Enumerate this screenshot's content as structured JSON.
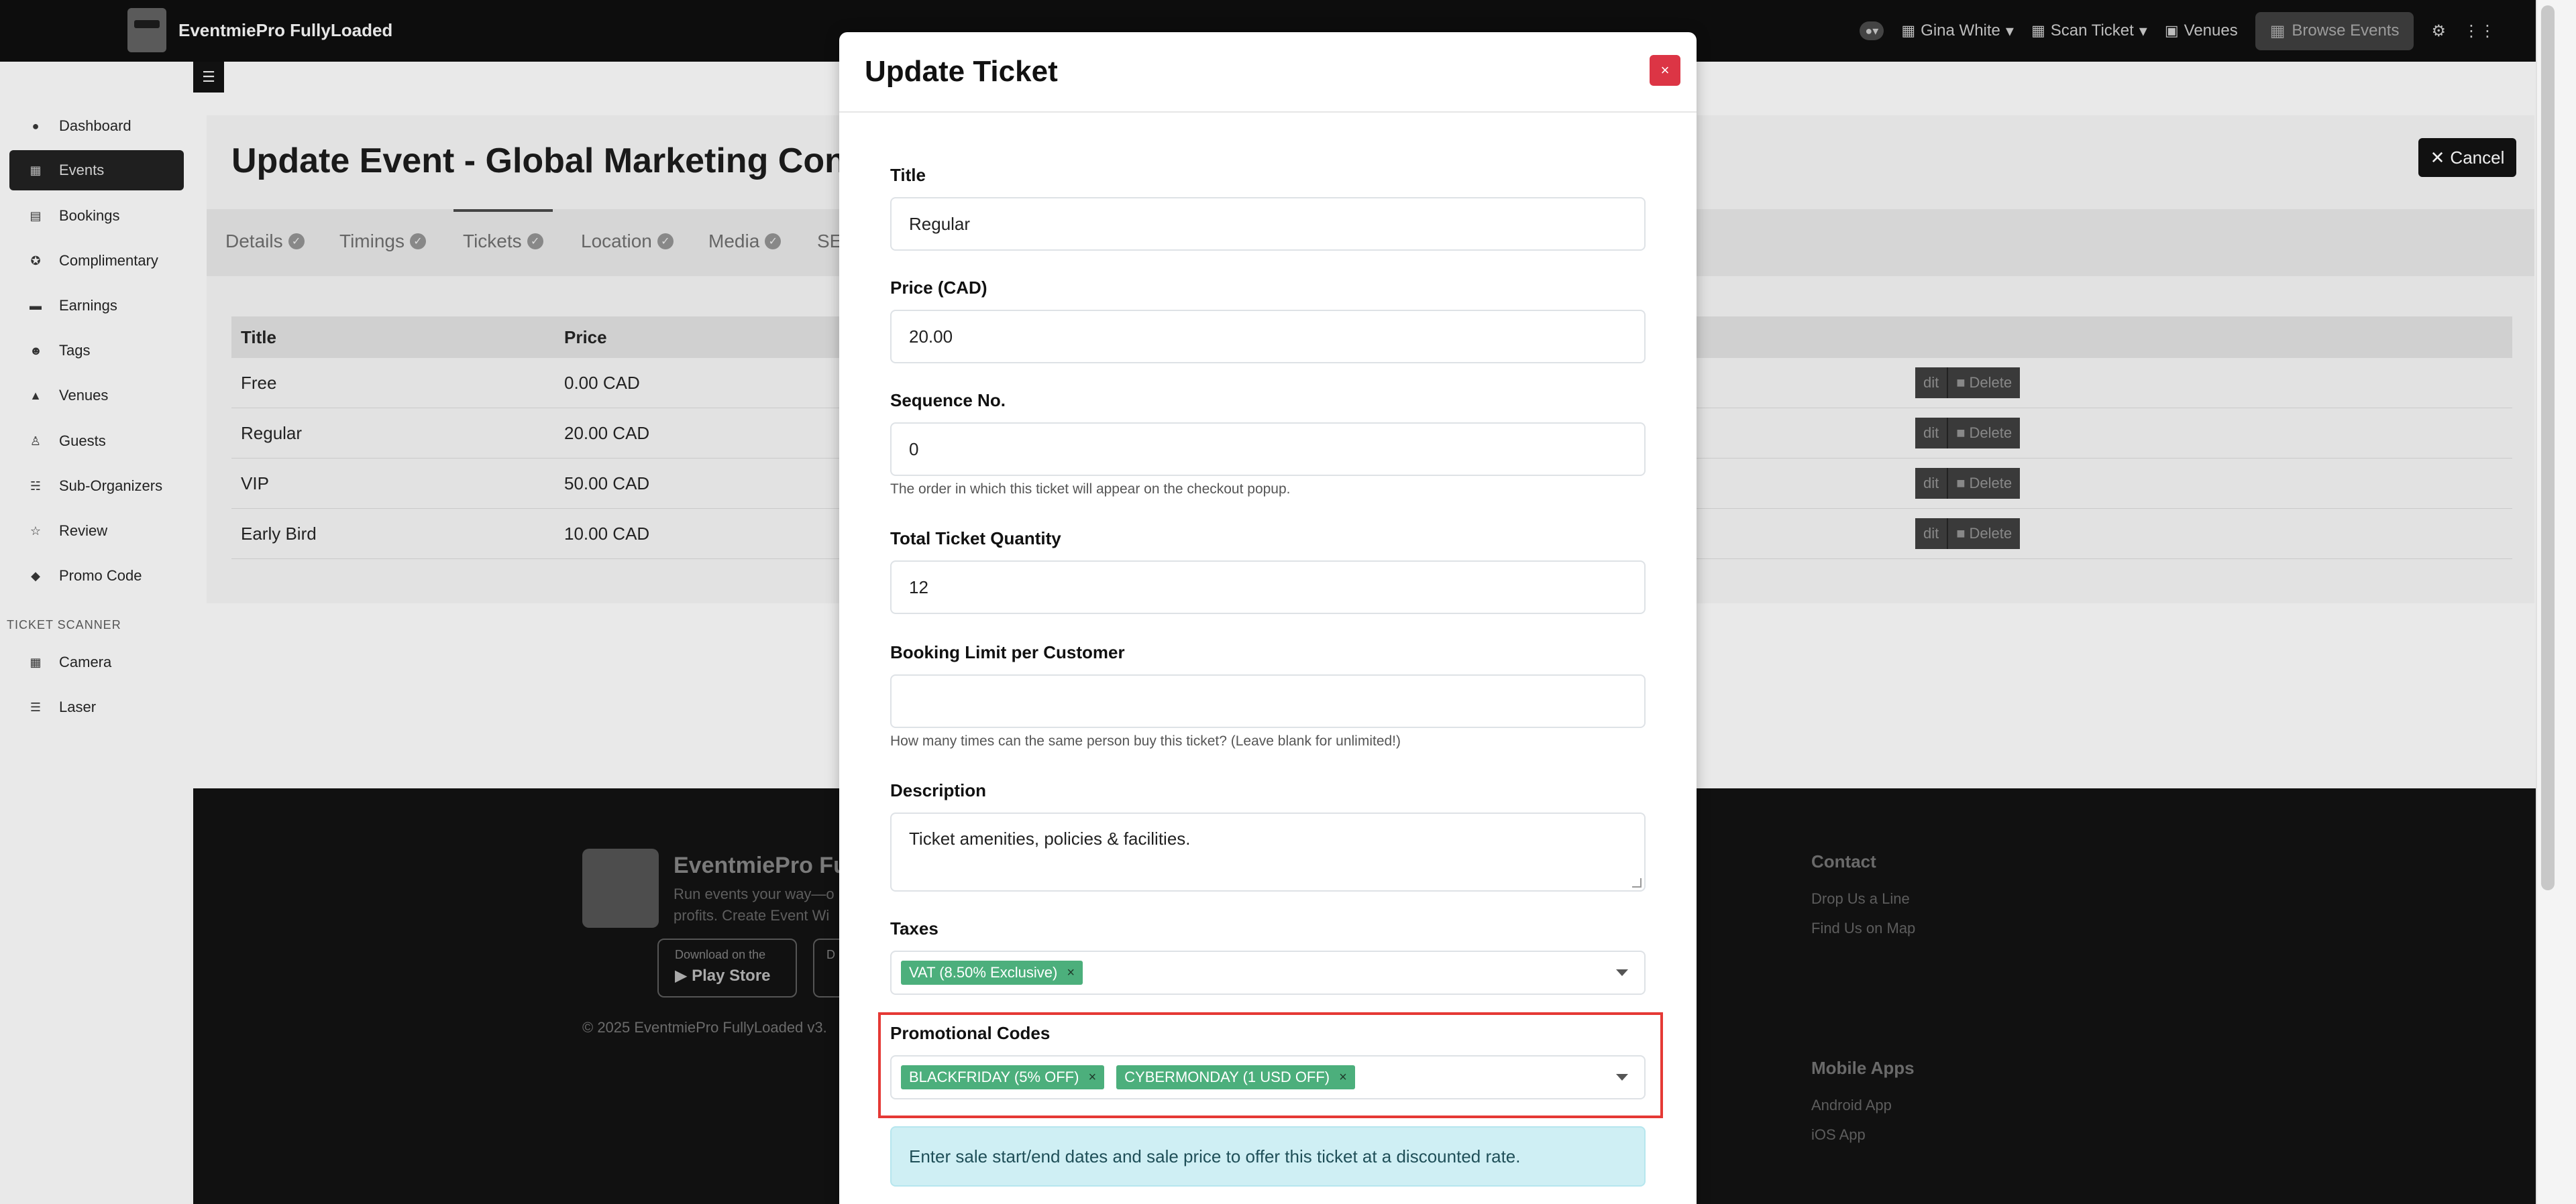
{
  "topbar": {
    "brand": "EventmiePro FullyLoaded",
    "user": "Gina White",
    "scan_ticket": "Scan Ticket",
    "venues": "Venues",
    "browse_events": "Browse Events"
  },
  "sidebar": {
    "items": [
      {
        "label": "Dashboard",
        "icon": "dashboard-icon"
      },
      {
        "label": "Events",
        "icon": "calendar-icon"
      },
      {
        "label": "Bookings",
        "icon": "bookings-icon"
      },
      {
        "label": "Complimentary",
        "icon": "puzzle-icon"
      },
      {
        "label": "Earnings",
        "icon": "wallet-icon"
      },
      {
        "label": "Tags",
        "icon": "tags-icon"
      },
      {
        "label": "Venues",
        "icon": "venues-icon"
      },
      {
        "label": "Guests",
        "icon": "guests-icon"
      },
      {
        "label": "Sub-Organizers",
        "icon": "org-icon"
      },
      {
        "label": "Review",
        "icon": "star-icon"
      },
      {
        "label": "Promo Code",
        "icon": "tag-icon"
      }
    ],
    "section_label": "TICKET SCANNER",
    "scanner_items": [
      {
        "label": "Camera",
        "icon": "camera-icon"
      },
      {
        "label": "Laser",
        "icon": "barcode-icon"
      }
    ]
  },
  "page": {
    "title": "Update Event - Global Marketing Confe",
    "cancel": "Cancel",
    "tabs": [
      "Details",
      "Timings",
      "Tickets",
      "Location",
      "Media",
      "SE"
    ],
    "table": {
      "headers": [
        "Title",
        "Price"
      ],
      "rows": [
        {
          "title": "Free",
          "price": "0.00 CAD"
        },
        {
          "title": "Regular",
          "price": "20.00 CAD"
        },
        {
          "title": "VIP",
          "price": "50.00 CAD"
        },
        {
          "title": "Early Bird",
          "price": "10.00 CAD"
        }
      ],
      "edit": "dit",
      "delete": "Delete"
    }
  },
  "footer": {
    "brand": "EventmiePro Ful",
    "tagline": "Run events your way—o profits. Create Event Wi",
    "store_small": "Download on the",
    "store_big": "Play Store",
    "store2_small": "D",
    "copyright": "© 2025 EventmiePro FullyLoaded v3.",
    "contact_heading": "Contact",
    "contact_links": [
      "Drop Us a Line",
      "Find Us on Map"
    ],
    "apps_heading": "Mobile Apps",
    "apps_links": [
      "Android App",
      "iOS App"
    ]
  },
  "modal": {
    "title": "Update Ticket",
    "close": "×",
    "fields": {
      "title_label": "Title",
      "title_value": "Regular",
      "price_label": "Price (CAD)",
      "price_value": "20.00",
      "sequence_label": "Sequence No.",
      "sequence_value": "0",
      "sequence_help": "The order in which this ticket will appear on the checkout popup.",
      "quantity_label": "Total Ticket Quantity",
      "quantity_value": "12",
      "limit_label": "Booking Limit per Customer",
      "limit_value": "",
      "limit_help": "How many times can the same person buy this ticket? (Leave blank for unlimited!)",
      "description_label": "Description",
      "description_value": "Ticket amenities, policies & facilities.",
      "taxes_label": "Taxes",
      "taxes": [
        "VAT (8.50% Exclusive)"
      ],
      "promo_label": "Promotional Codes",
      "promo_codes": [
        "BLACKFRIDAY (5% OFF)",
        "CYBERMONDAY (1 USD OFF)"
      ],
      "sale_info": "Enter sale start/end dates and sale price to offer this ticket at a discounted rate."
    }
  },
  "colors": {
    "chip": "#4caf7c",
    "close_button": "#dc3545",
    "highlight": "#e53935",
    "info_bg": "#cfeff4"
  }
}
